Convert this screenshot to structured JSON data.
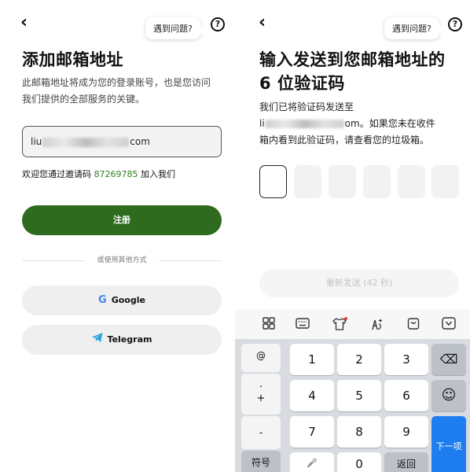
{
  "left": {
    "help_label": "遇到问题?",
    "help_icon_glyph": "?",
    "title": "添加邮箱地址",
    "description_line1": "此邮箱地址将成为您的登录账号，也是您访问",
    "description_line2": "我们提供的全部服务的关键。",
    "email_prefix": "liu",
    "email_suffix": "com",
    "invite_before": "欢迎您通过邀请码 ",
    "invite_code": "87269785",
    "invite_after": " 加入我们",
    "register_label": "注册",
    "divider_text": "或使用其他方式",
    "google_label": "Google",
    "google_glyph": "G",
    "telegram_label": "Telegram"
  },
  "right": {
    "help_label": "遇到问题?",
    "help_icon_glyph": "?",
    "title_line1": "输入发送到您邮箱地址的",
    "title_line2": "6 位验证码",
    "desc_line1": "我们已将验证码发送至",
    "email_prefix": "li",
    "email_suffix": "om。如果您未在收件",
    "desc_line3": "箱内看到此验证码，请查看您的垃圾箱。",
    "code_boxes": 6,
    "resend_label": "重新发送 (42 秒)"
  },
  "keyboard": {
    "left_column": [
      "@",
      ".",
      "+",
      "-"
    ],
    "digits_row1": [
      "1",
      "2",
      "3"
    ],
    "digits_row2": [
      "4",
      "5",
      "6"
    ],
    "digits_row3": [
      "7",
      "8",
      "9"
    ],
    "symbols_label": "符号",
    "zero": "0",
    "return_label": "返回",
    "next_label": "下一项",
    "backspace_glyph": "⌫",
    "emoji_glyph": "☺",
    "mic_glyph": "🎤",
    "toolbar_icons": [
      "grid-icon",
      "keyboard-icon",
      "shirt-icon",
      "gesture-icon",
      "clipboard-icon",
      "collapse-icon"
    ]
  },
  "colors": {
    "primary_green": "#2e6b1e",
    "invite_code_green": "#2e7d1f",
    "next_key_blue": "#1e7ef0"
  }
}
